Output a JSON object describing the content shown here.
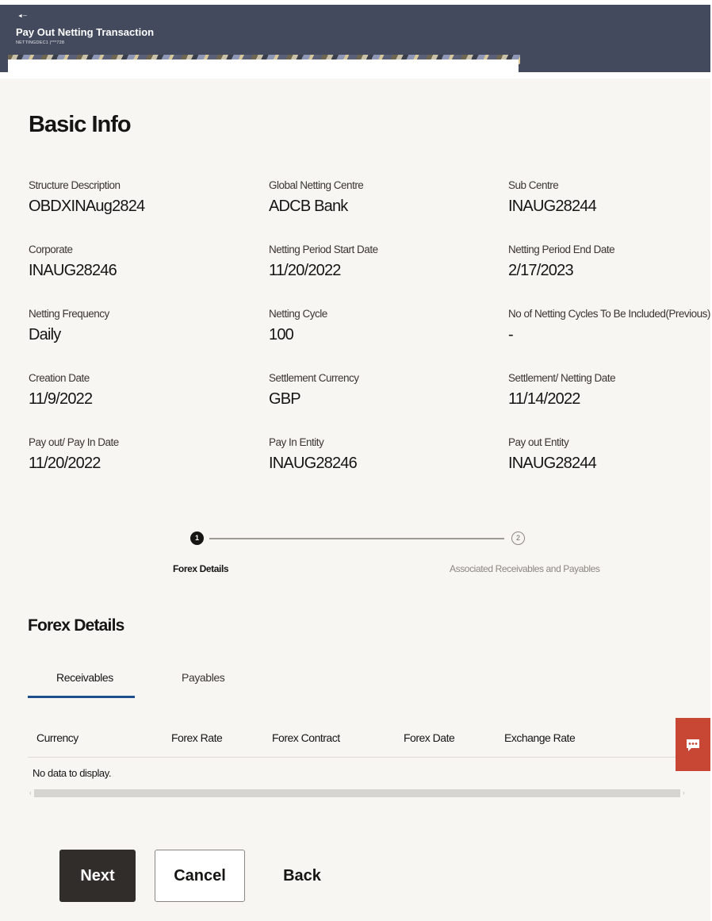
{
  "header": {
    "title": "Pay Out Netting Transaction",
    "subtitle": "NETTINGDEC1 |***728"
  },
  "basic_info": {
    "title": "Basic Info",
    "fields": [
      {
        "label": "Structure Description",
        "value": "OBDXINAug2824"
      },
      {
        "label": "Global Netting Centre",
        "value": "ADCB Bank"
      },
      {
        "label": "Sub Centre",
        "value": "INAUG28244"
      },
      {
        "label": "Corporate",
        "value": "INAUG28246"
      },
      {
        "label": "Netting Period Start Date",
        "value": "11/20/2022"
      },
      {
        "label": "Netting Period End Date",
        "value": "2/17/2023"
      },
      {
        "label": "Netting Frequency",
        "value": "Daily"
      },
      {
        "label": "Netting Cycle",
        "value": "100"
      },
      {
        "label": "No of Netting Cycles To Be Included(Previous)",
        "value": "-"
      },
      {
        "label": "Creation Date",
        "value": "11/9/2022"
      },
      {
        "label": "Settlement Currency",
        "value": "GBP"
      },
      {
        "label": "Settlement/ Netting Date",
        "value": "11/14/2022"
      },
      {
        "label": "Pay out/ Pay In Date",
        "value": "11/20/2022"
      },
      {
        "label": "Pay In Entity",
        "value": "INAUG28246"
      },
      {
        "label": "Pay out Entity",
        "value": "INAUG28244"
      }
    ]
  },
  "stepper": {
    "steps": [
      {
        "number": "1",
        "label": "Forex Details"
      },
      {
        "number": "2",
        "label": "Associated Receivables and Payables"
      }
    ]
  },
  "forex": {
    "title": "Forex Details",
    "tabs": [
      {
        "label": "Receivables"
      },
      {
        "label": "Payables"
      }
    ],
    "columns": [
      "Currency",
      "Forex Rate",
      "Forex Contract",
      "Forex Date",
      "Exchange Rate"
    ],
    "empty_message": "No data to display."
  },
  "chat": {
    "icon": "chat-icon"
  },
  "actions": {
    "next_label": "Next",
    "cancel_label": "Cancel",
    "back_label": "Back"
  },
  "colors": {
    "header_bg": "#434a5e",
    "panel_bg": "#f7f6f3",
    "primary_button": "#312d2a",
    "tab_accent": "#1f4e8c",
    "chat_button": "#c74634"
  }
}
